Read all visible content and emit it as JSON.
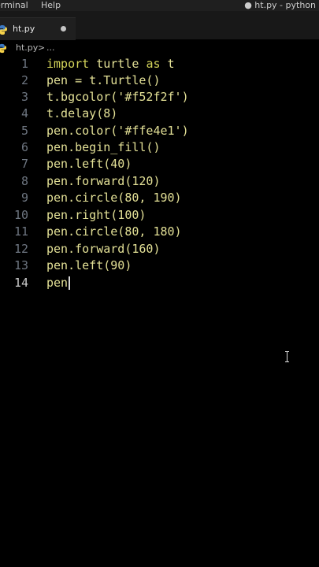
{
  "menu": {
    "items": [
      "erminal",
      "Help"
    ],
    "window_title": "● ht.py - python"
  },
  "tab": {
    "label": "ht.py",
    "icon": "python-icon",
    "modified": true
  },
  "breadcrumb": {
    "file": "ht.py",
    "separator": ">",
    "more": "..."
  },
  "editor": {
    "lines": [
      {
        "num": "1",
        "text": "import turtle as t"
      },
      {
        "num": "2",
        "text": "pen = t.Turtle()"
      },
      {
        "num": "3",
        "text": "t.bgcolor('#f52f2f')"
      },
      {
        "num": "4",
        "text": "t.delay(8)"
      },
      {
        "num": "5",
        "text": "pen.color('#ffe4e1')"
      },
      {
        "num": "6",
        "text": "pen.begin_fill()"
      },
      {
        "num": "7",
        "text": "pen.left(40)"
      },
      {
        "num": "8",
        "text": "pen.forward(120)"
      },
      {
        "num": "9",
        "text": "pen.circle(80, 190)"
      },
      {
        "num": "10",
        "text": "pen.right(100)"
      },
      {
        "num": "11",
        "text": "pen.circle(80, 180)"
      },
      {
        "num": "12",
        "text": "pen.forward(160)"
      },
      {
        "num": "13",
        "text": "pen.left(90)"
      },
      {
        "num": "14",
        "text": "pen"
      }
    ],
    "active_line": 14
  },
  "colors": {
    "background": "#000000",
    "code": "#e3e096",
    "line_number": "#6e7681"
  }
}
